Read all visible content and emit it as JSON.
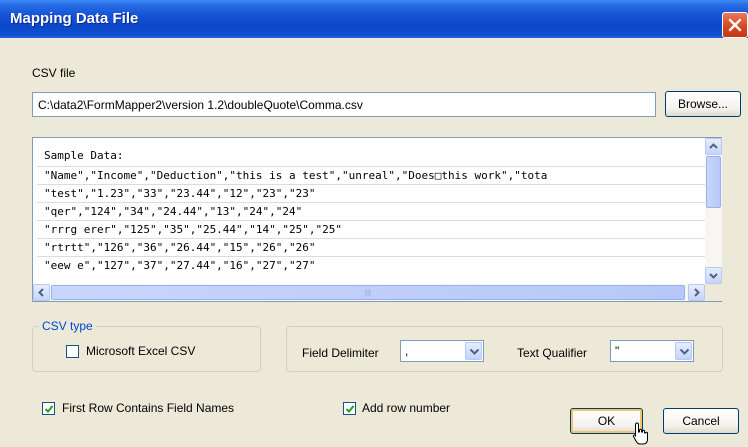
{
  "window": {
    "title": "Mapping Data File"
  },
  "csv_file": {
    "label": "CSV file",
    "path": "C:\\data2\\FormMapper2\\version 1.2\\doubleQuote\\Comma.csv",
    "browse_label": "Browse..."
  },
  "sample": {
    "header": "Sample Data:",
    "rows": [
      "\"Name\",\"Income\",\"Deduction\",\"this is a test\",\"unreal\",\"Does□this work\",\"tota",
      "\"test\",\"1.23\",\"33\",\"23.44\",\"12\",\"23\",\"23\"",
      "\"qer\",\"124\",\"34\",\"24.44\",\"13\",\"24\",\"24\"",
      "\"rrrg erer\",\"125\",\"35\",\"25.44\",\"14\",\"25\",\"25\"",
      "\"rtrtt\",\"126\",\"36\",\"26.44\",\"15\",\"26\",\"26\"",
      "\"eew e\",\"127\",\"37\",\"27.44\",\"16\",\"27\",\"27\""
    ],
    "hscroll_grip": "|||"
  },
  "csv_type": {
    "group_label": "CSV type",
    "excel_label": "Microsoft Excel CSV",
    "excel_checked": false
  },
  "delimiters": {
    "field_label": "Field Delimiter",
    "field_value": ",",
    "qualifier_label": "Text Qualifier",
    "qualifier_value": "\""
  },
  "options": {
    "first_row_label": "First Row Contains Field Names",
    "first_row_checked": true,
    "add_row_label": "Add row number",
    "add_row_checked": true
  },
  "buttons": {
    "ok": "OK",
    "cancel": "Cancel"
  },
  "colors": {
    "title_bar": "#0d47c9",
    "group_label": "#0046d5",
    "close_button": "#d4451f",
    "dialog_bg": "#ece9d8"
  }
}
